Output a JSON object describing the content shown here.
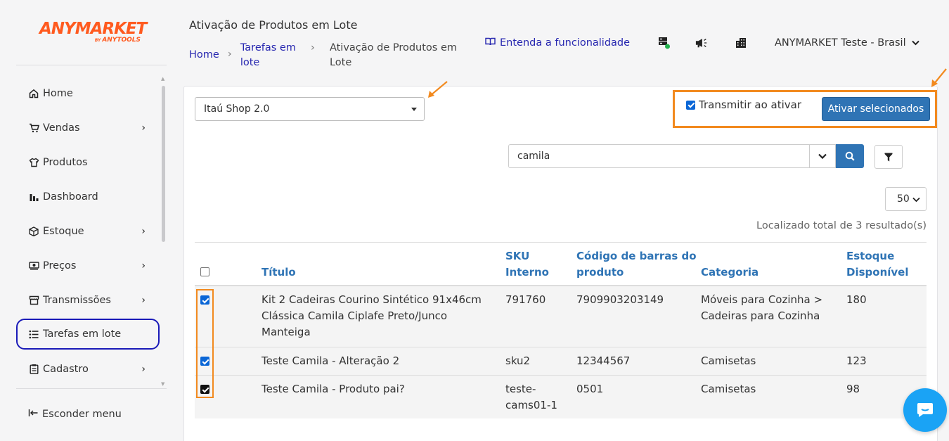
{
  "brand": {
    "name": "ANYMARKET",
    "by": "BY",
    "sub": "ANYTOOLS",
    "color": "#ff5a1f"
  },
  "sidebar": {
    "items": [
      {
        "label": "Home",
        "icon": "home-icon",
        "has_children": false
      },
      {
        "label": "Vendas",
        "icon": "cart-icon",
        "has_children": true
      },
      {
        "label": "Produtos",
        "icon": "shirt-icon",
        "has_children": false
      },
      {
        "label": "Dashboard",
        "icon": "bar-chart-icon",
        "has_children": false
      },
      {
        "label": "Estoque",
        "icon": "box-icon",
        "has_children": true
      },
      {
        "label": "Preços",
        "icon": "money-icon",
        "has_children": true
      },
      {
        "label": "Transmissões",
        "icon": "store-icon",
        "has_children": true
      },
      {
        "label": "Tarefas em lote",
        "icon": "list-icon",
        "has_children": false,
        "active": true
      },
      {
        "label": "Cadastro",
        "icon": "clipboard-icon",
        "has_children": true
      }
    ],
    "hide_menu_label": "Esconder menu"
  },
  "header": {
    "title": "Ativação de Produtos em Lote",
    "breadcrumb": {
      "home": "Home",
      "tasks_line1": "Tarefas em",
      "tasks_line2": "lote",
      "current_line1": "Ativação de Produtos em",
      "current_line2": "Lote"
    },
    "help_link": "Entenda a funcionalidade",
    "account": "ANYMARKET Teste - Brasil"
  },
  "toolbar": {
    "channel_selected": "Itaú Shop 2.0",
    "transmit_label": "Transmitir ao ativar",
    "transmit_checked": true,
    "activate_label": "Ativar selecionados",
    "search_value": "camila",
    "page_size": "50",
    "result_text": "Localizado total de 3 resultado(s)"
  },
  "table": {
    "headers": {
      "title": "Título",
      "sku_line1": "SKU",
      "sku_line2": "Interno",
      "barcode_line1": "Código de barras do",
      "barcode_line2": "produto",
      "category": "Categoria",
      "stock_line1": "Estoque",
      "stock_line2": "Disponível"
    },
    "rows": [
      {
        "checked": true,
        "title": [
          "Kit 2 Cadeiras Courino Sintético 91x46cm",
          "Clássica Camila Ciplafe Preto/Junco",
          "Manteiga"
        ],
        "sku": [
          "791760"
        ],
        "barcode": "7909903203149",
        "category": [
          "Móveis para Cozinha >",
          "Cadeiras para Cozinha"
        ],
        "stock": "180"
      },
      {
        "checked": true,
        "title": [
          "Teste Camila - Alteração 2"
        ],
        "sku": [
          "sku2"
        ],
        "barcode": "12344567",
        "category": [
          "Camisetas"
        ],
        "stock": "123"
      },
      {
        "checked": true,
        "title": [
          "Teste Camila - Produto pai?"
        ],
        "sku": [
          "teste-",
          "cams01-1"
        ],
        "barcode": "0501",
        "category": [
          "Camisetas"
        ],
        "stock": "98"
      }
    ]
  },
  "colors": {
    "accent": "#2f74b5",
    "highlight": "#f28a1f",
    "active_nav": "#1a1ab8",
    "chat": "#1aa3f5"
  }
}
